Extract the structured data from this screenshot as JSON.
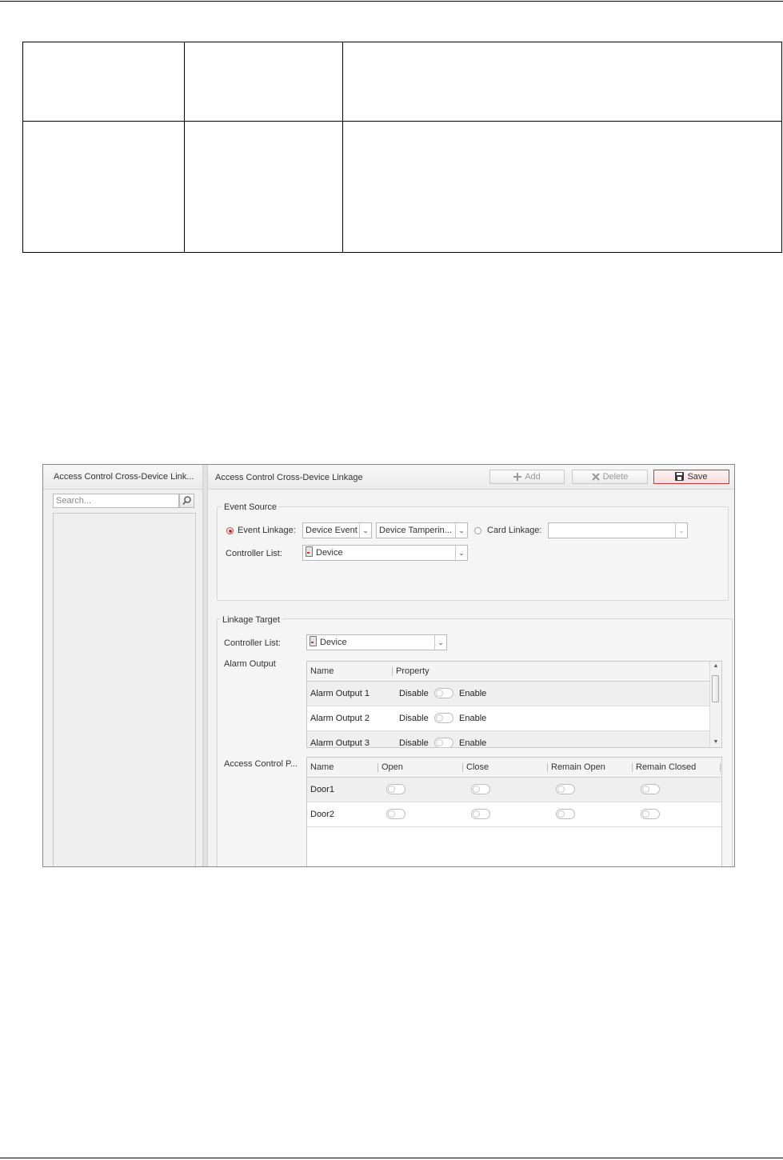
{
  "app": {
    "left_panel_title": "Access Control Cross-Device Link...",
    "search_placeholder": "Search...",
    "right_panel_title": "Access Control Cross-Device Linkage",
    "toolbar": {
      "add_label": "Add",
      "delete_label": "Delete",
      "save_label": "Save"
    },
    "event_source": {
      "legend": "Event Source",
      "event_linkage_label": "Event Linkage:",
      "event_type_value": "Device Event",
      "event_value": "Device Tamperin...",
      "card_linkage_label": "Card Linkage:",
      "card_linkage_value": "",
      "controller_list_label": "Controller List:",
      "controller_value": "Device"
    },
    "linkage_target": {
      "legend": "Linkage Target",
      "controller_list_label": "Controller List:",
      "controller_value": "Device",
      "alarm_output_label": "Alarm Output",
      "alarm_table": {
        "headers": [
          "Name",
          "Property"
        ],
        "disable_label": "Disable",
        "enable_label": "Enable",
        "rows": [
          "Alarm Output 1",
          "Alarm Output 2",
          "Alarm Output 3"
        ]
      },
      "access_point_label": "Access Control P...",
      "door_table": {
        "headers": [
          "Name",
          "Open",
          "Close",
          "Remain Open",
          "Remain Closed"
        ],
        "rows": [
          "Door1",
          "Door2"
        ]
      }
    }
  }
}
